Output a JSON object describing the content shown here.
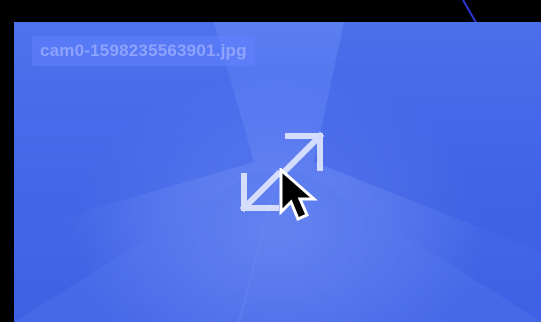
{
  "thumbnail": {
    "filename": "cam0-1598235563901.jpg"
  },
  "icons": {
    "expand": "expand-icon",
    "cursor": "mouse-pointer-icon"
  },
  "colors": {
    "image_tint": "#4c70ee",
    "label_bg": "#6482ff",
    "icon_stroke": "#dfe6ff",
    "frame": "#000000"
  }
}
